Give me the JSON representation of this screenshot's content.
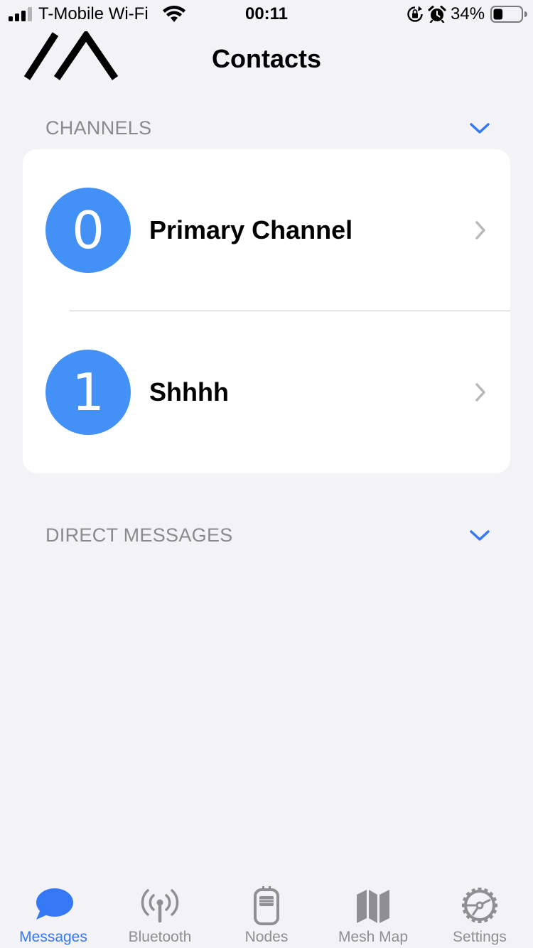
{
  "status_bar": {
    "carrier": "T-Mobile Wi-Fi",
    "time": "00:11",
    "battery_percent": "34%",
    "battery_level": 0.34,
    "icons": [
      "signal-icon",
      "wifi-icon",
      "rotation-lock-icon",
      "alarm-icon",
      "battery-icon"
    ]
  },
  "nav": {
    "title": "Contacts",
    "logo_icon": "meshtastic-logo"
  },
  "channels": {
    "header": "CHANNELS",
    "items": [
      {
        "index": "0",
        "label": "Primary Channel"
      },
      {
        "index": "1",
        "label": "Shhhh"
      }
    ]
  },
  "direct_messages": {
    "header": "DIRECT MESSAGES"
  },
  "tab_bar": {
    "tabs": [
      {
        "label": "Messages",
        "icon": "message-bubble-icon",
        "active": true
      },
      {
        "label": "Bluetooth",
        "icon": "antenna-icon",
        "active": false
      },
      {
        "label": "Nodes",
        "icon": "device-icon",
        "active": false
      },
      {
        "label": "Mesh Map",
        "icon": "map-icon",
        "active": false
      },
      {
        "label": "Settings",
        "icon": "gear-icon",
        "active": false
      }
    ]
  },
  "colors": {
    "accent": "#3478f6",
    "avatar": "#4390f7",
    "background": "#f2f2f7",
    "secondary_text": "#8a8a8e"
  }
}
